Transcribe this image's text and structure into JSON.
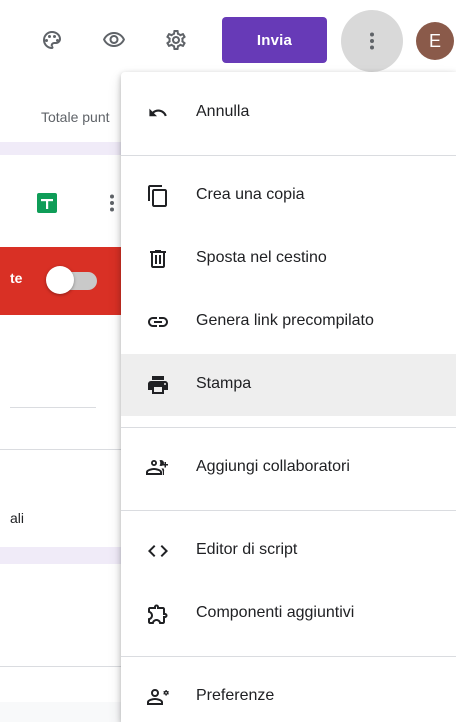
{
  "toolbar": {
    "send_label": "Invia",
    "avatar_initial": "E",
    "avatar_color": "#8a5a4a",
    "send_color": "#673ab7",
    "icons": [
      "palette-icon",
      "eye-icon",
      "gear-icon",
      "more-vert-icon"
    ]
  },
  "background": {
    "total_points_label": "Totale punt",
    "banner_label": "te",
    "row_label": "ali",
    "banner_color": "#d93025"
  },
  "menu": {
    "items": [
      {
        "label": "Annulla",
        "icon": "undo-icon"
      },
      {
        "label": "Crea una copia",
        "icon": "copy-icon"
      },
      {
        "label": "Sposta nel cestino",
        "icon": "trash-icon"
      },
      {
        "label": "Genera link precompilato",
        "icon": "link-icon"
      },
      {
        "label": "Stampa",
        "icon": "print-icon",
        "highlighted": true
      },
      {
        "label": "Aggiungi collaboratori",
        "icon": "add-people-icon"
      },
      {
        "label": "Editor di script",
        "icon": "code-icon"
      },
      {
        "label": "Componenti aggiuntivi",
        "icon": "puzzle-icon"
      },
      {
        "label": "Preferenze",
        "icon": "person-settings-icon"
      }
    ]
  }
}
